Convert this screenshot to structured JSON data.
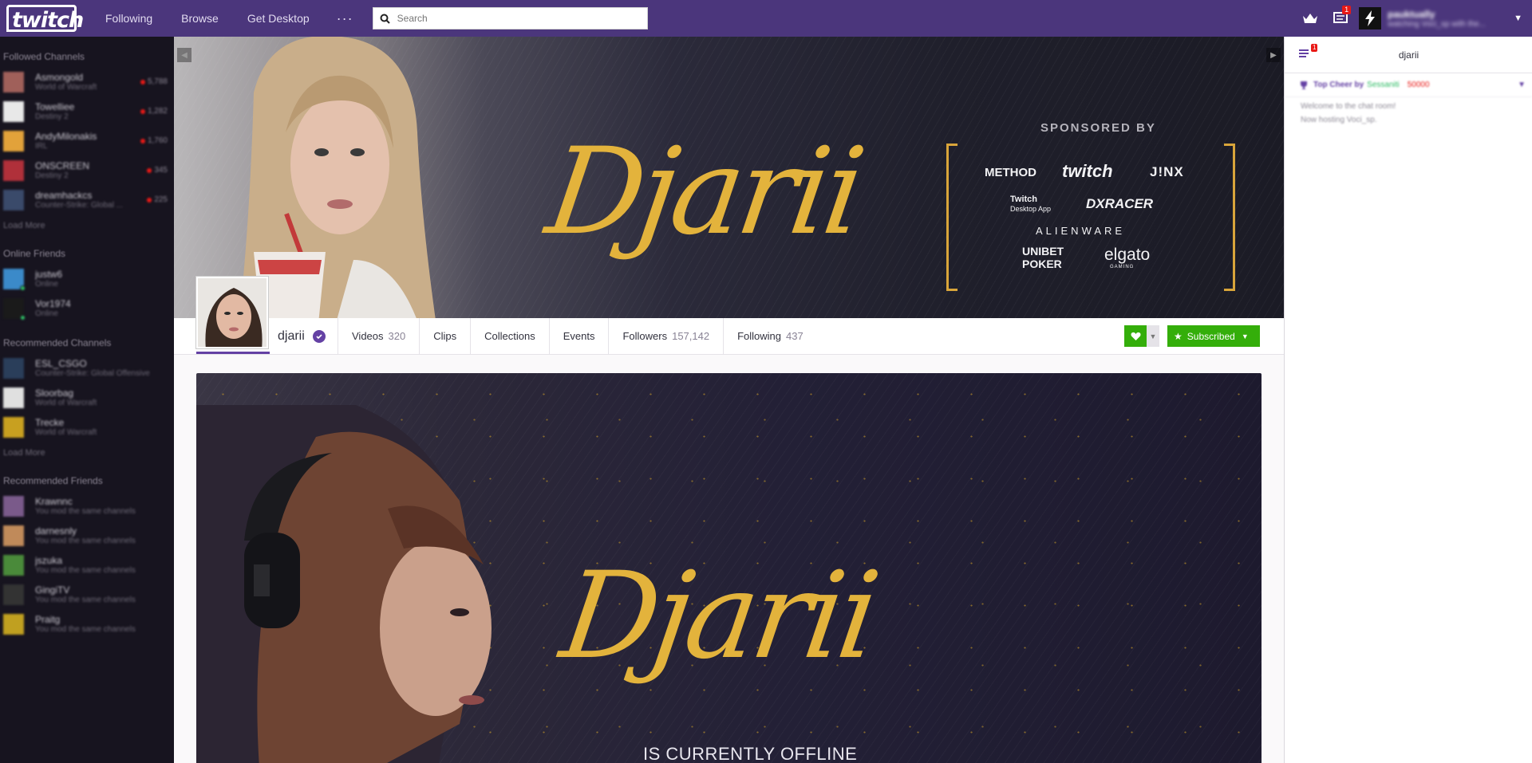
{
  "nav": {
    "logo": "twitch",
    "links": [
      "Following",
      "Browse",
      "Get Desktop"
    ],
    "more": "···",
    "search_placeholder": "Search",
    "notification_badge": "1",
    "user": {
      "name": "pauktually",
      "status": "watching Voci_sp with the..."
    }
  },
  "sidebar": {
    "followed_title": "Followed Channels",
    "followed": [
      {
        "name": "Asmongold",
        "game": "World of Warcraft",
        "viewers": "5,788",
        "avatar_color": "#a0605a"
      },
      {
        "name": "Towelliee",
        "game": "Destiny 2",
        "viewers": "1,282",
        "avatar_color": "#e8e8e8"
      },
      {
        "name": "AndyMilonakis",
        "game": "IRL",
        "viewers": "1,760",
        "avatar_color": "#e2a23a"
      },
      {
        "name": "ONSCREEN",
        "game": "Destiny 2",
        "viewers": "345",
        "avatar_color": "#b0303a"
      },
      {
        "name": "dreamhackcs",
        "game": "Counter-Strike: Global ...",
        "viewers": "225",
        "avatar_color": "#3a4a6a"
      }
    ],
    "load_more": "Load More",
    "friends_title": "Online Friends",
    "friends": [
      {
        "name": "justw6",
        "status": "Online",
        "avatar_color": "#3b8ac9"
      },
      {
        "name": "Vor1974",
        "status": "Online",
        "avatar_color": "#1a1a1a"
      }
    ],
    "recommended_title": "Recommended Channels",
    "recommended": [
      {
        "name": "ESL_CSGO",
        "game": "Counter-Strike: Global Offensive",
        "avatar_color": "#2a3e5a"
      },
      {
        "name": "Sloorbag",
        "game": "World of Warcraft",
        "avatar_color": "#e0e0e0"
      },
      {
        "name": "Trecke",
        "game": "World of Warcraft",
        "avatar_color": "#c8a020"
      }
    ],
    "load_more_2": "Load More",
    "rec_friends_title": "Recommended Friends",
    "rec_friends": [
      {
        "name": "Krawnnc",
        "status": "You mod the same channels",
        "avatar_color": "#7a5a8a"
      },
      {
        "name": "darnesnly",
        "status": "You mod the same channels",
        "avatar_color": "#c08a5a"
      },
      {
        "name": "jszuka",
        "status": "You mod the same channels",
        "avatar_color": "#4a8a3a"
      },
      {
        "name": "GingiTV",
        "status": "You mod the same channels",
        "avatar_color": "#333333"
      },
      {
        "name": "Praitg",
        "status": "You mod the same channels",
        "avatar_color": "#c0a020"
      }
    ]
  },
  "banner": {
    "logo_text": "Djarii",
    "sponsored_by": "SPONSORED BY",
    "sponsors": [
      "METHOD",
      "twitch",
      "J!NX",
      "Twitch",
      "Desktop App",
      "DXRACER",
      "ALIENWARE",
      "UNIBET",
      "POKER",
      "elgato",
      "GAMING"
    ]
  },
  "profile": {
    "name": "djarii",
    "tabs": [
      {
        "label": "Videos",
        "count": "320"
      },
      {
        "label": "Clips",
        "count": ""
      },
      {
        "label": "Collections",
        "count": ""
      },
      {
        "label": "Events",
        "count": ""
      },
      {
        "label": "Followers",
        "count": "157,142"
      },
      {
        "label": "Following",
        "count": "437"
      }
    ],
    "subscribed_label": "Subscribed"
  },
  "offline": {
    "logo_text": "Djarii",
    "message": "IS CURRENTLY OFFLINE"
  },
  "chat": {
    "title": "djarii",
    "badge": "1",
    "top_cheer_label": "Top Cheer by",
    "top_cheer_user": "Sessaniti",
    "top_cheer_amount": "50000",
    "messages": [
      "Welcome to the chat room!",
      "Now hosting Voci_sp."
    ]
  },
  "colors": {
    "brand": "#6441a4",
    "nav": "#4b367c",
    "sidebar": "#17141f",
    "follow_green": "#34ae0a",
    "accent_gold": "#e3b33c"
  }
}
